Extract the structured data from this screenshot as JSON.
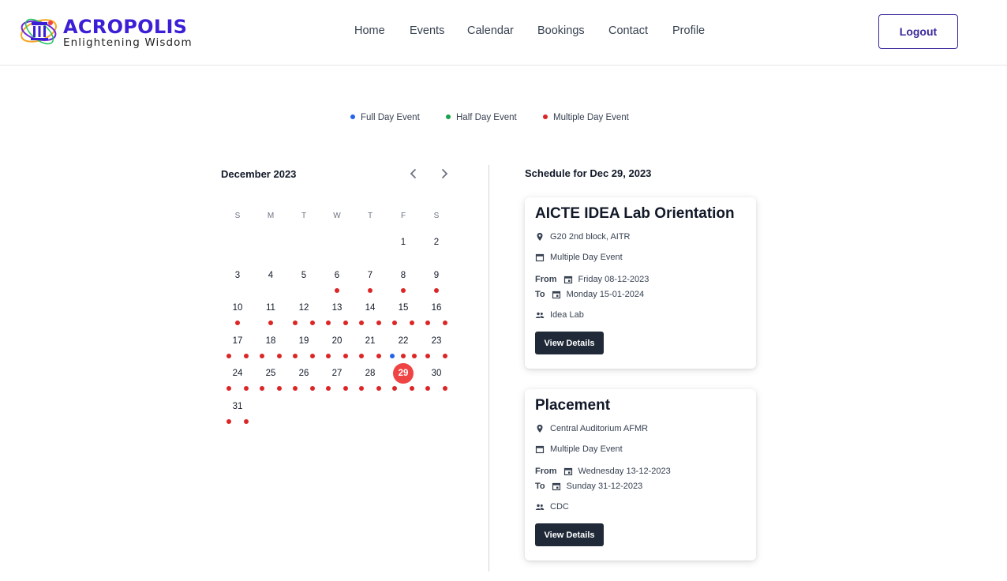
{
  "header": {
    "logo_title": "ACROPOLIS",
    "logo_tagline": "Enlightening Wisdom",
    "nav": [
      "Home",
      "Events",
      "Calendar",
      "Bookings",
      "Contact",
      "Profile"
    ],
    "logout_label": "Logout"
  },
  "legend": [
    {
      "label": "Full Day Event",
      "color": "#2563eb"
    },
    {
      "label": "Half Day Event",
      "color": "#16a34a"
    },
    {
      "label": "Multiple Day Event",
      "color": "#dc2626"
    }
  ],
  "calendar": {
    "month_label": "December 2023",
    "weekdays": [
      "S",
      "M",
      "T",
      "W",
      "T",
      "F",
      "S"
    ],
    "first_weekday_index": 5,
    "days_in_month": 31,
    "selected_day": 29,
    "selected_color": "#ef4444",
    "event_dots": {
      "6": [
        "multi"
      ],
      "7": [
        "multi"
      ],
      "8": [
        "multi"
      ],
      "9": [
        "multi"
      ],
      "10": [
        "multi"
      ],
      "11": [
        "multi"
      ],
      "12": [
        "multi",
        "multi"
      ],
      "13": [
        "multi",
        "multi"
      ],
      "14": [
        "multi",
        "multi"
      ],
      "15": [
        "multi",
        "multi"
      ],
      "16": [
        "multi",
        "multi"
      ],
      "17": [
        "multi",
        "multi"
      ],
      "18": [
        "multi",
        "multi"
      ],
      "19": [
        "multi",
        "multi"
      ],
      "20": [
        "multi",
        "multi"
      ],
      "21": [
        "multi",
        "multi"
      ],
      "22": [
        "full",
        "multi",
        "multi"
      ],
      "23": [
        "multi",
        "multi"
      ],
      "24": [
        "multi",
        "multi"
      ],
      "25": [
        "multi",
        "multi"
      ],
      "26": [
        "multi",
        "multi"
      ],
      "27": [
        "multi",
        "multi"
      ],
      "28": [
        "multi",
        "multi"
      ],
      "29": [
        "multi",
        "multi"
      ],
      "30": [
        "multi",
        "multi"
      ],
      "31": [
        "multi",
        "multi"
      ]
    },
    "dot_colors": {
      "full": "#2563eb",
      "half": "#16a34a",
      "multi": "#dc2626"
    }
  },
  "schedule": {
    "title": "Schedule for Dec 29, 2023",
    "events": [
      {
        "title": "AICTE IDEA Lab Orientation",
        "location": "G20 2nd block, AITR",
        "type": "Multiple Day Event",
        "from_label": "From",
        "from": "Friday 08-12-2023",
        "to_label": "To",
        "to": "Monday 15-01-2024",
        "organizer": "Idea Lab",
        "button": "View Details"
      },
      {
        "title": "Placement",
        "location": "Central Auditorium AFMR",
        "type": "Multiple Day Event",
        "from_label": "From",
        "from": "Wednesday 13-12-2023",
        "to_label": "To",
        "to": "Sunday 31-12-2023",
        "organizer": "CDC",
        "button": "View Details"
      }
    ]
  }
}
